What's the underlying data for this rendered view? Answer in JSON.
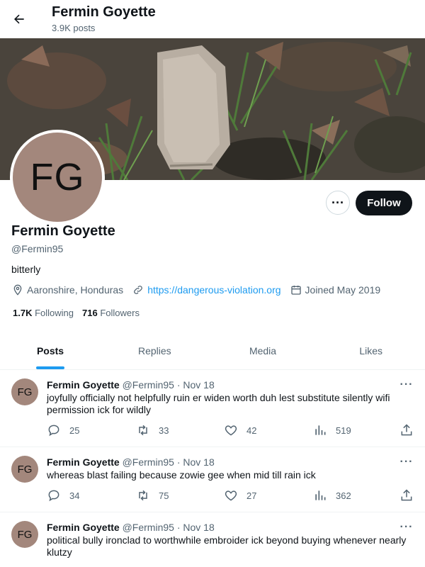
{
  "header": {
    "name": "Fermin Goyette",
    "posts_count": "3.9K posts"
  },
  "profile": {
    "avatar_initials": "FG",
    "name": "Fermin Goyette",
    "handle": "@Fermin95",
    "bio": "bitterly",
    "location": "Aaronshire, Honduras",
    "website": "https://dangerous-violation.org",
    "joined": "Joined May 2019",
    "following_count": "1.7K",
    "following_label": "Following",
    "followers_count": "716",
    "followers_label": "Followers",
    "follow_label": "Follow",
    "more_label": "···"
  },
  "tabs": [
    {
      "label": "Posts",
      "active": true
    },
    {
      "label": "Replies",
      "active": false
    },
    {
      "label": "Media",
      "active": false
    },
    {
      "label": "Likes",
      "active": false
    }
  ],
  "tweets": [
    {
      "avatar": "FG",
      "name": "Fermin Goyette",
      "handle": "@Fermin95 · Nov 18",
      "text": "joyfully officially not helpfully ruin er widen worth duh lest substitute silently wifi permission ick for wildly",
      "replies": "25",
      "retweets": "33",
      "likes": "42",
      "views": "519"
    },
    {
      "avatar": "FG",
      "name": "Fermin Goyette",
      "handle": "@Fermin95 · Nov 18",
      "text": "whereas blast failing because zowie gee when mid till rain ick",
      "replies": "34",
      "retweets": "75",
      "likes": "27",
      "views": "362"
    },
    {
      "avatar": "FG",
      "name": "Fermin Goyette",
      "handle": "@Fermin95 · Nov 18",
      "text": "political bully ironclad to worthwhile embroider ick beyond buying whenever nearly klutzy",
      "replies": "",
      "retweets": "",
      "likes": "",
      "views": ""
    }
  ],
  "colors": {
    "accent": "#1d9bf0",
    "avatar_bg": "#a3877c",
    "follow_bg": "#0f1419"
  },
  "icons": {
    "back": "arrow-left-icon",
    "location": "location-pin-icon",
    "link": "link-icon",
    "calendar": "calendar-icon",
    "reply": "reply-icon",
    "retweet": "retweet-icon",
    "like": "heart-icon",
    "views": "views-icon",
    "share": "share-icon"
  }
}
